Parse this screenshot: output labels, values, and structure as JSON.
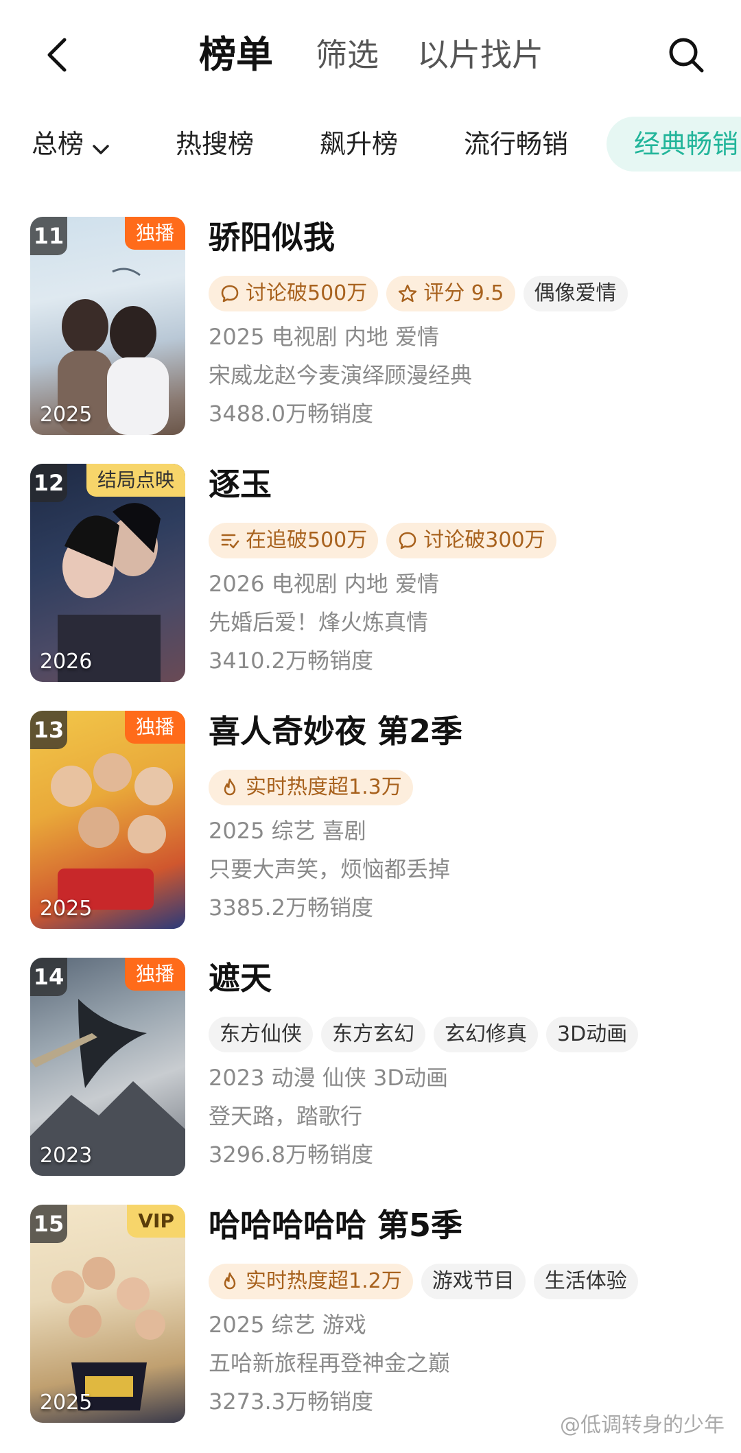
{
  "header": {
    "tabs": [
      {
        "label": "榜单",
        "active": true
      },
      {
        "label": "筛选",
        "active": false
      },
      {
        "label": "以片找片",
        "active": false
      }
    ],
    "back_icon": "back-arrow-icon",
    "search_icon": "search-icon"
  },
  "categories": [
    {
      "label": "总榜",
      "has_dropdown": true
    },
    {
      "label": "热搜榜"
    },
    {
      "label": "飙升榜"
    },
    {
      "label": "流行畅销"
    },
    {
      "label": "经典畅销",
      "active": true
    }
  ],
  "colors": {
    "accent": "#22b59a",
    "accent_bg": "#e6f7f3",
    "hot_tag_bg": "#fdeedd",
    "hot_tag_text": "#a8621e",
    "badge_orange": "#ff6b1a",
    "badge_yellow": "#f7d56a"
  },
  "items": [
    {
      "rank": "11",
      "badge": "独播",
      "badge_style": "orange",
      "year": "2025",
      "title": "骄阳似我",
      "tags": [
        {
          "icon": "chat-bubble-icon",
          "text": "讨论破500万",
          "style": "hot"
        },
        {
          "icon": "star-icon",
          "text": "评分 9.5",
          "style": "hot"
        },
        {
          "text": "偶像爱情",
          "style": "plain"
        }
      ],
      "meta": "2025 电视剧 内地 爱情",
      "desc": "宋威龙赵今麦演绎顾漫经典",
      "sales": "3488.0万畅销度"
    },
    {
      "rank": "12",
      "badge": "结局点映",
      "badge_style": "yellow",
      "year": "2026",
      "title": "逐玉",
      "tags": [
        {
          "icon": "list-check-icon",
          "text": "在追破500万",
          "style": "hot"
        },
        {
          "icon": "chat-bubble-icon",
          "text": "讨论破300万",
          "style": "hot"
        }
      ],
      "meta": "2026 电视剧 内地 爱情",
      "desc": "先婚后爱！烽火炼真情",
      "sales": "3410.2万畅销度"
    },
    {
      "rank": "13",
      "badge": "独播",
      "badge_style": "orange",
      "year": "2025",
      "title": "喜人奇妙夜 第2季",
      "tags": [
        {
          "icon": "flame-icon",
          "text": "实时热度超1.3万",
          "style": "hot"
        }
      ],
      "meta": "2025 综艺 喜剧",
      "desc": "只要大声笑，烦恼都丢掉",
      "sales": "3385.2万畅销度"
    },
    {
      "rank": "14",
      "badge": "独播",
      "badge_style": "orange",
      "year": "2023",
      "title": "遮天",
      "tags": [
        {
          "text": "东方仙侠",
          "style": "plain"
        },
        {
          "text": "东方玄幻",
          "style": "plain"
        },
        {
          "text": "玄幻修真",
          "style": "plain"
        },
        {
          "text": "3D动画",
          "style": "plain"
        }
      ],
      "meta": "2023 动漫 仙侠 3D动画",
      "desc": "登天路，踏歌行",
      "sales": "3296.8万畅销度"
    },
    {
      "rank": "15",
      "badge": "VIP",
      "badge_style": "vip",
      "year": "2025",
      "title": "哈哈哈哈哈 第5季",
      "tags": [
        {
          "icon": "flame-icon",
          "text": "实时热度超1.2万",
          "style": "hot"
        },
        {
          "text": "游戏节目",
          "style": "plain"
        },
        {
          "text": "生活体验",
          "style": "plain"
        }
      ],
      "meta": "2025 综艺 游戏",
      "desc": "五哈新旅程再登神金之巅",
      "sales": "3273.3万畅销度"
    }
  ],
  "watermark": "@低调转身的少年"
}
